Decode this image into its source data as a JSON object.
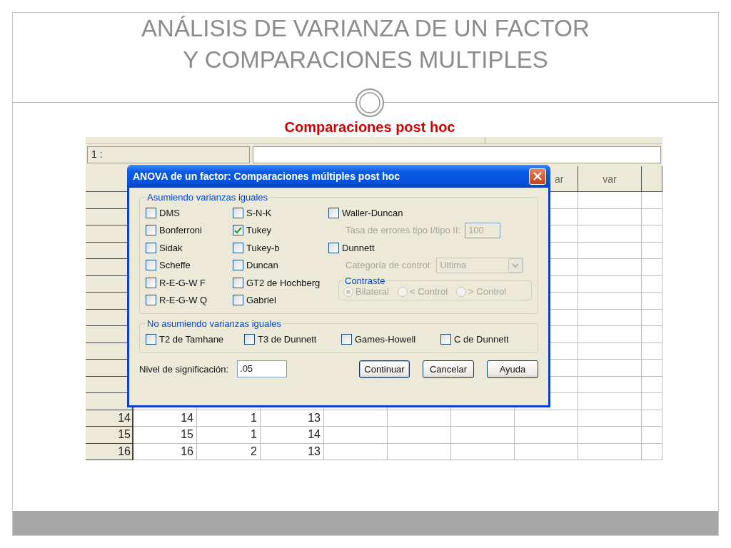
{
  "slide": {
    "title_lines": [
      "ANÁLISIS DE VARIANZA DE UN FACTOR",
      "Y COMPARACIONES MULTIPLES"
    ],
    "subtitle": "Comparaciones post hoc"
  },
  "editor": {
    "cell_ref": "1 :",
    "column_headers": [
      {
        "label": "ar"
      },
      {
        "label": "var"
      }
    ],
    "rows": [
      {
        "header": "14",
        "cells": [
          "14",
          "1",
          "13"
        ]
      },
      {
        "header": "15",
        "cells": [
          "15",
          "1",
          "14"
        ]
      },
      {
        "header": "16",
        "cells": [
          "16",
          "2",
          "13"
        ]
      }
    ]
  },
  "dialog": {
    "title": "ANOVA de un factor: Comparaciones múltiples post hoc",
    "equal_variances": {
      "legend": "Asumiendo varianzas iguales",
      "options": [
        {
          "label": "DMS",
          "checked": false
        },
        {
          "label": "Bonferroni",
          "checked": false
        },
        {
          "label": "Sidak",
          "checked": false
        },
        {
          "label": "Scheffe",
          "checked": false
        },
        {
          "label": "R-E-G-W F",
          "checked": false
        },
        {
          "label": "R-E-G-W Q",
          "checked": false
        },
        {
          "label": "S-N-K",
          "checked": false
        },
        {
          "label": "Tukey",
          "checked": true
        },
        {
          "label": "Tukey-b",
          "checked": false
        },
        {
          "label": "Duncan",
          "checked": false
        },
        {
          "label": "GT2 de Hochberg",
          "checked": false
        },
        {
          "label": "Gabriel",
          "checked": false
        }
      ],
      "waller_duncan": {
        "label": "Waller-Duncan",
        "checked": false
      },
      "error_rate": {
        "label": "Tasa de errores tipo I/tipo II:",
        "value": "100",
        "disabled": true
      },
      "dunnett": {
        "label": "Dunnett",
        "checked": false
      },
      "control_category": {
        "label": "Categoría de control:",
        "value": "Ultima",
        "disabled": true
      },
      "contrast": {
        "legend": "Contraste",
        "disabled": true,
        "options": [
          {
            "label": "Bilateral",
            "selected": true
          },
          {
            "label": "< Control",
            "selected": false
          },
          {
            "label": "> Control",
            "selected": false
          }
        ]
      }
    },
    "unequal_variances": {
      "legend": "No asumiendo varianzas iguales",
      "options": [
        {
          "label": "T2 de Tamhane",
          "checked": false
        },
        {
          "label": "T3 de Dunnett",
          "checked": false
        },
        {
          "label": "Games-Howell",
          "checked": false
        },
        {
          "label": "C de Dunnett",
          "checked": false
        }
      ]
    },
    "significance": {
      "label": "Nivel de significación:",
      "value": ".05"
    },
    "buttons": [
      {
        "label": "Continuar",
        "default": true
      },
      {
        "label": "Cancelar",
        "default": false
      },
      {
        "label": "Ayuda",
        "default": false
      }
    ]
  }
}
